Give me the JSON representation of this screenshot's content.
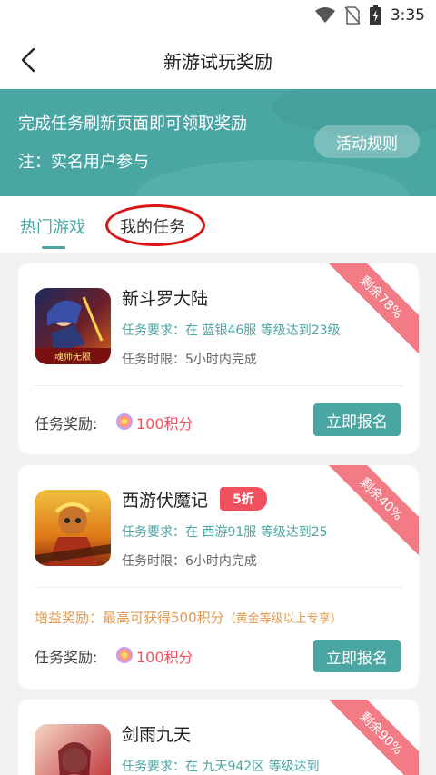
{
  "status_bar": {
    "time": "3:35"
  },
  "header": {
    "title": "新游试玩奖励"
  },
  "banner": {
    "line1": "完成任务刷新页面即可领取奖励",
    "line2": "注：实名用户参与",
    "rules_label": "活动规则"
  },
  "tabs": [
    {
      "label": "热门游戏",
      "active": true
    },
    {
      "label": "我的任务",
      "active": false
    }
  ],
  "labels": {
    "reward": "任务奖励:",
    "join": "立即报名"
  },
  "games": [
    {
      "name": "新斗罗大陆",
      "ribbon": "剩余78%",
      "requirement": "任务要求：在 蓝银46服 等级达到23级",
      "time_limit": "任务时限：5小时内完成",
      "reward": "100积分",
      "icon_caption": "魂师无限"
    },
    {
      "name": "西游伏魔记",
      "discount": "5折",
      "ribbon": "剩余40%",
      "requirement": "任务要求：在 西游91服 等级达到25",
      "time_limit": "任务时限：6小时内完成",
      "bonus": "增益奖励：最高可获得500积分",
      "bonus_note": "（黄金等级以上专享）",
      "reward": "100积分"
    },
    {
      "name": "剑雨九天",
      "ribbon": "剩余90%",
      "requirement": "任务要求：在 九天942区 等级达到"
    }
  ],
  "colors": {
    "accent": "#4aa6a3",
    "ribbon": "#f27b86",
    "price": "#f1505e",
    "bonus": "#e29a52",
    "highlight": "#d81414"
  }
}
